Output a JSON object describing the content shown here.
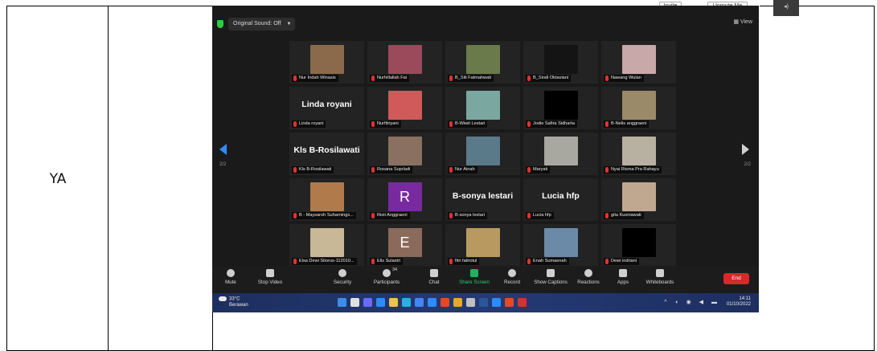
{
  "table": {
    "cell_text": "YA"
  },
  "top_strip": {
    "invite": "Invite",
    "unmute": "Unmute Me",
    "thumb_icon": "speaker-icon"
  },
  "meeting": {
    "sound": "Original Sound: Off",
    "view": "View",
    "page": "2/2",
    "participants": [
      {
        "name": "Nur Indah Winasis",
        "tile": "photo",
        "color": "#8a6a4a"
      },
      {
        "name": "Nurhillallah Fai",
        "tile": "photo",
        "color": "#9a4a5a"
      },
      {
        "name": "B_Siti Fatmahwati",
        "tile": "photo",
        "color": "#6a7a4a"
      },
      {
        "name": "B_Sindi Oktaviani",
        "tile": "photo",
        "color": "#141414"
      },
      {
        "name": "Nawang Wulan",
        "tile": "photo",
        "color": "#c8a8a8"
      },
      {
        "name": "Linda royani",
        "tile": "name",
        "big": "Linda royani"
      },
      {
        "name": "Nurfitriyani",
        "tile": "photo",
        "color": "#d05a5a"
      },
      {
        "name": "B-Wiwit Lestari",
        "tile": "photo",
        "color": "#7aa8a0"
      },
      {
        "name": "Jodie Safira Sidharta",
        "tile": "black"
      },
      {
        "name": "B-Nelis anggraeni",
        "tile": "photo",
        "color": "#9a8a6a"
      },
      {
        "name": "Kls B-Rosilawati",
        "tile": "name",
        "big": "Kls B-Rosilawati"
      },
      {
        "name": "Rosana Suprladi",
        "tile": "photo",
        "color": "#8a7060"
      },
      {
        "name": "Nur Ainah",
        "tile": "photo",
        "color": "#5a7a8a"
      },
      {
        "name": "Maryati",
        "tile": "photo",
        "color": "#a8a8a0"
      },
      {
        "name": "Nyai Risma Pra Rahayu",
        "tile": "photo",
        "color": "#b8b0a0"
      },
      {
        "name": "B - Maysaroh Suharnings...",
        "tile": "photo",
        "color": "#b07a4a"
      },
      {
        "name": "Risti Anggraeni",
        "tile": "letter",
        "letter": "R",
        "color": "#7a2aa0"
      },
      {
        "name": "B-sonya lestari",
        "tile": "name",
        "big": "B-sonya lestari"
      },
      {
        "name": "Lucia hfp",
        "tile": "name",
        "big": "Lucia hfp"
      },
      {
        "name": "gita Kusniawati",
        "tile": "photo",
        "color": "#c0a890"
      },
      {
        "name": "Elsa Dewi Sitorus-112010...",
        "tile": "photo",
        "color": "#c8b898"
      },
      {
        "name": "Elis Sulastri",
        "tile": "letter",
        "letter": "E",
        "color": "#8a6a5a"
      },
      {
        "name": "fitri fatirotul",
        "tile": "photo",
        "color": "#b89a60"
      },
      {
        "name": "Enah Sumaenah",
        "tile": "photo",
        "color": "#6a8aa8"
      },
      {
        "name": "Dewi indriani",
        "tile": "black"
      }
    ],
    "toolbar": {
      "mute": "Mute",
      "stop_video": "Stop Video",
      "security": "Security",
      "participants": "Participants",
      "participant_count": "34",
      "chat": "Chat",
      "share_screen": "Share Screen",
      "record": "Record",
      "captions": "Show Captions",
      "reactions": "Reactions",
      "apps": "Apps",
      "whiteboards": "Whiteboards",
      "end": "End"
    }
  },
  "taskbar": {
    "temp": "33°C",
    "weather": "Berawan",
    "time": "14:11",
    "date": "01/10/2022",
    "app_colors": [
      "#3a8ee6",
      "#e0e0e0",
      "#6a6aff",
      "#2d8cff",
      "#f2c14e",
      "#2ab0e0",
      "#4285f4",
      "#2d8cff",
      "#e04a2a",
      "#e8a82a",
      "#c0c0c0",
      "#2b579a",
      "#2d8cff",
      "#e34a2a",
      "#d0342c"
    ]
  }
}
